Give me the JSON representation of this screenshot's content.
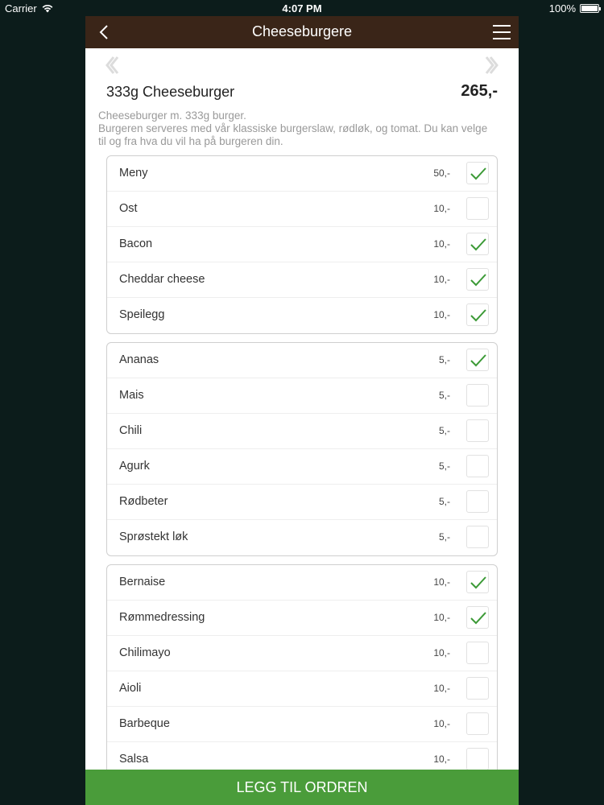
{
  "status_bar": {
    "carrier": "Carrier",
    "time": "4:07 PM",
    "battery": "100%"
  },
  "navbar": {
    "title": "Cheeseburgere"
  },
  "product": {
    "name": "333g Cheeseburger",
    "price": "265,-",
    "description_line1": "Cheeseburger m. 333g burger.",
    "description_line2": "Burgeren serveres med vår klassiske burgerslaw, rødløk, og tomat. Du kan velge til og fra hva du vil ha på burgeren din."
  },
  "groups": [
    {
      "items": [
        {
          "label": "Meny",
          "price": "50,-",
          "checked": true
        },
        {
          "label": "Ost",
          "price": "10,-",
          "checked": false
        },
        {
          "label": "Bacon",
          "price": "10,-",
          "checked": true
        },
        {
          "label": "Cheddar cheese",
          "price": "10,-",
          "checked": true
        },
        {
          "label": "Speilegg",
          "price": "10,-",
          "checked": true
        }
      ]
    },
    {
      "items": [
        {
          "label": "Ananas",
          "price": "5,-",
          "checked": true
        },
        {
          "label": "Mais",
          "price": "5,-",
          "checked": false
        },
        {
          "label": "Chili",
          "price": "5,-",
          "checked": false
        },
        {
          "label": "Agurk",
          "price": "5,-",
          "checked": false
        },
        {
          "label": "Rødbeter",
          "price": "5,-",
          "checked": false
        },
        {
          "label": "Sprøstekt løk",
          "price": "5,-",
          "checked": false
        }
      ]
    },
    {
      "items": [
        {
          "label": "Bernaise",
          "price": "10,-",
          "checked": true
        },
        {
          "label": "Rømmedressing",
          "price": "10,-",
          "checked": true
        },
        {
          "label": "Chilimayo",
          "price": "10,-",
          "checked": false
        },
        {
          "label": "Aioli",
          "price": "10,-",
          "checked": false
        },
        {
          "label": "Barbeque",
          "price": "10,-",
          "checked": false
        },
        {
          "label": "Salsa",
          "price": "10,-",
          "checked": false
        }
      ]
    }
  ],
  "actions": {
    "add_to_order": "LEGG TIL ORDREN"
  },
  "colors": {
    "navbar": "#3a2518",
    "accent_green": "#4a9c3a",
    "checkmark": "#3c9a37",
    "background": "#0c1c1b"
  }
}
